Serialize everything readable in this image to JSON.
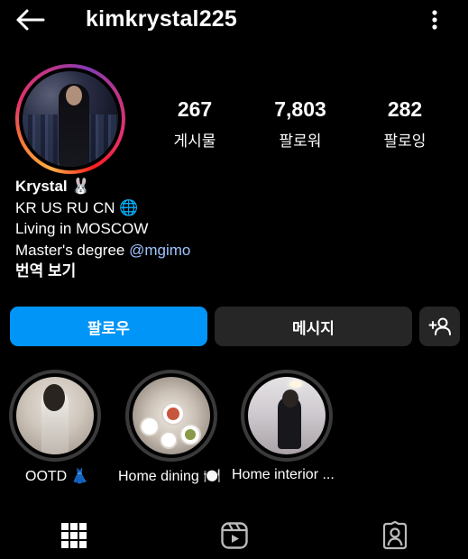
{
  "header": {
    "username": "kimkrystal225",
    "back_icon": "arrow-left-icon",
    "menu_icon": "more-vertical-icon"
  },
  "profile": {
    "avatar_icon": "profile-avatar",
    "stats": [
      {
        "value": "267",
        "label": "게시물"
      },
      {
        "value": "7,803",
        "label": "팔로워"
      },
      {
        "value": "282",
        "label": "팔로잉"
      }
    ]
  },
  "bio": {
    "name": "Krystal 🐰",
    "line1": "KR US RU CN 🌐",
    "line2": "Living in MOSCOW",
    "line3_prefix": "Master's degree ",
    "line3_link": "@mgimo",
    "translate": "번역 보기"
  },
  "actions": {
    "follow": "팔로우",
    "message": "메시지",
    "add_user_icon": "person-add-icon"
  },
  "highlights": [
    {
      "label": "OOTD 👗"
    },
    {
      "label": "Home dining 🍽️"
    },
    {
      "label": "Home interior ..."
    }
  ],
  "tabs": [
    {
      "icon": "grid-icon"
    },
    {
      "icon": "reels-icon"
    },
    {
      "icon": "tagged-icon"
    }
  ],
  "colors": {
    "accent": "#0095f6",
    "link": "#9fc5ff",
    "button_dark": "#262626",
    "background": "#000000"
  }
}
